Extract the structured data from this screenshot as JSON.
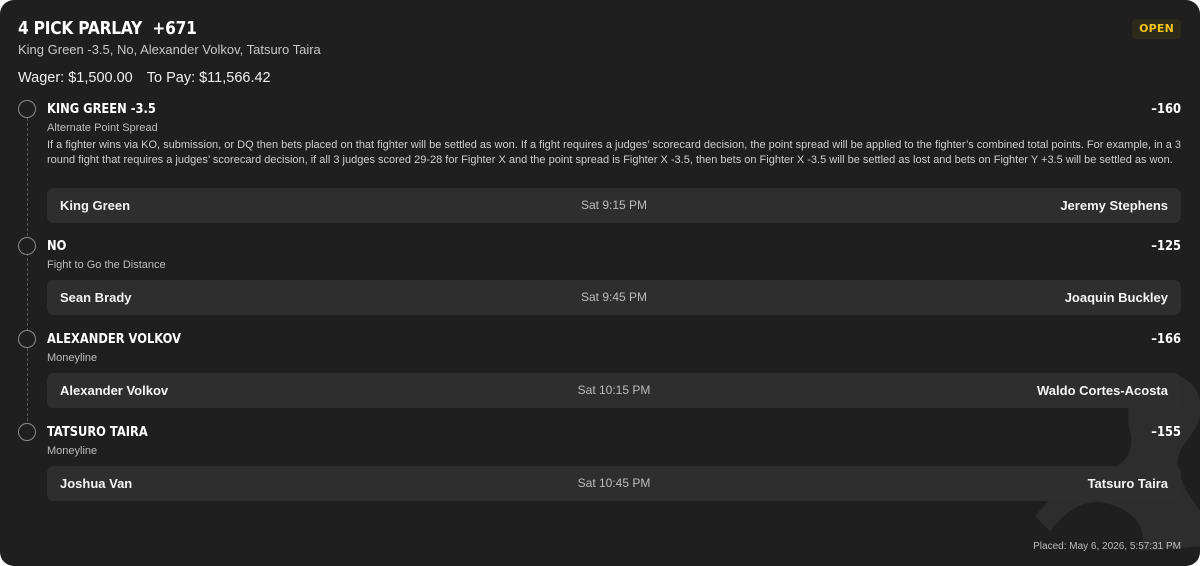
{
  "bet": {
    "title": "4 PICK PARLAY",
    "odds": "+671",
    "status": "OPEN",
    "summary": "King Green -3.5, No, Alexander Volkov, Tatsuro Taira",
    "wager_label": "Wager: $1,500.00",
    "to_pay_label": "To Pay: $11,566.42",
    "placed": "Placed: May 6, 2026, 5:57:31 PM"
  },
  "legs": [
    {
      "pick": "KING GREEN -3.5",
      "odds": "–160",
      "market": "Alternate Point Spread",
      "rules": "If a fighter wins via KO, submission, or DQ then bets placed on that fighter will be settled as won. If a fight requires a judges’ scorecard decision, the point spread will be applied to the fighter’s combined total points. For example, in a 3 round fight that requires a judges’ scorecard decision, if all 3 judges scored 29-28 for Fighter X and the point spread is Fighter X -3.5, then bets on Fighter X -3.5 will be settled as lost and bets on Fighter Y +3.5 will be settled as won.",
      "home": "King Green",
      "time": "Sat 9:15 PM",
      "away": "Jeremy Stephens"
    },
    {
      "pick": "NO",
      "odds": "–125",
      "market": "Fight to Go the Distance",
      "home": "Sean Brady",
      "time": "Sat 9:45 PM",
      "away": "Joaquin Buckley"
    },
    {
      "pick": "ALEXANDER VOLKOV",
      "odds": "–166",
      "market": "Moneyline",
      "home": "Alexander Volkov",
      "time": "Sat 10:15 PM",
      "away": "Waldo Cortes-Acosta"
    },
    {
      "pick": "TATSURO TAIRA",
      "odds": "–155",
      "market": "Moneyline",
      "home": "Joshua Van",
      "time": "Sat 10:45 PM",
      "away": "Tatsuro Taira"
    }
  ],
  "colors": {
    "background": "#1f1f1f",
    "row_background": "#2e2e2e",
    "status_text": "#f3c318"
  }
}
